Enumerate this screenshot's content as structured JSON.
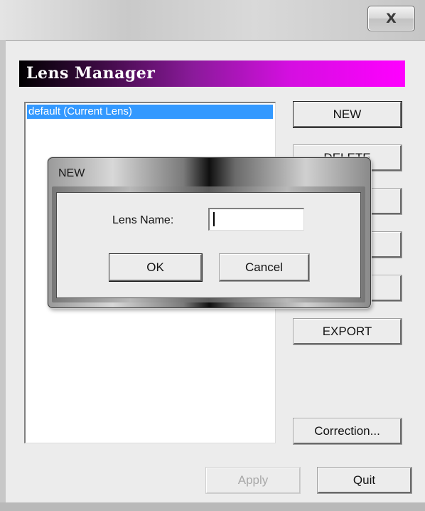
{
  "window": {
    "close_glyph": "X"
  },
  "banner": {
    "title": "Lens Manager",
    "gradient_start": "#000000",
    "gradient_end": "#ff00ff"
  },
  "lens_list": {
    "items": [
      {
        "label": "default (Current Lens)",
        "selected": true
      }
    ],
    "selection_color": "#3399ff"
  },
  "side_buttons": {
    "new_label": "NEW",
    "delete_label": "DELETE",
    "export_label": "EXPORT",
    "correction_label": "Correction..."
  },
  "footer": {
    "apply_label": "Apply",
    "quit_label": "Quit"
  },
  "new_dialog": {
    "title": "NEW",
    "lens_name_label": "Lens Name:",
    "lens_name_value": "",
    "ok_label": "OK",
    "cancel_label": "Cancel"
  }
}
